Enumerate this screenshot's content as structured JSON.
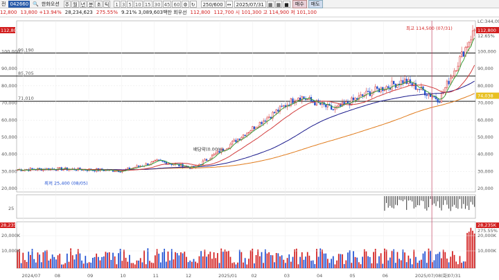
{
  "toolbar": {
    "stock_code": "042660",
    "stock_name": "한화오션",
    "periods": [
      "주",
      "월",
      "년",
      "분",
      "초",
      "틱"
    ],
    "minute_intervals": [
      "1",
      "3",
      "5",
      "10",
      "15",
      "30",
      "45",
      "60"
    ],
    "count_value": "250/600",
    "date_value": "2025/07/31",
    "buy_label": "매수",
    "sell_label": "매도",
    "period_prefix": "전"
  },
  "infobar": {
    "price": "12,800",
    "change": "13,800 +13.94%",
    "volume": "28,234,623",
    "turnover_ratio": "275.55%",
    "summary": "9.21% 3,089,603백만 회우선",
    "open_info": "112,800",
    "high_label": "112,700 시 101,300 고 114,900 저 101,100"
  },
  "chart_data": {
    "type": "candlestick",
    "period": "daily",
    "x_ticks": [
      "2024/07",
      "08",
      "09",
      "10",
      "11",
      "12",
      "2025/01",
      "02",
      "03",
      "04",
      "05",
      "06",
      "2025/07/08(화)",
      "07/31"
    ],
    "price_axis": {
      "ticks": [
        "100,000",
        "90,000",
        "80,000",
        "70,000",
        "60,000",
        "50,000",
        "40,000",
        "30,000",
        "20,000"
      ],
      "ylim": [
        18000,
        118000
      ],
      "current_tag": "112,800",
      "current_tag2": "74,038",
      "lc_label": "LC:344,09",
      "lc_label2": "12.65%"
    },
    "horizontal_lines": [
      {
        "label": "99,190",
        "value": 99190
      },
      {
        "label": "85,705",
        "value": 85705
      },
      {
        "label": "71,010",
        "value": 71010
      }
    ],
    "annotations": {
      "high": "최고 114,500 (07/31)",
      "low": "최저 25,400 (08/05)",
      "dividend": "배당락(0.00%)"
    },
    "monthly_closes_approx": [
      31000,
      31500,
      31000,
      30500,
      36000,
      32000,
      45000,
      60000,
      74000,
      66000,
      76000,
      83000,
      72000,
      112800
    ],
    "ma_long_end": 78000,
    "ma_mid_end": 82000,
    "sub_indicator": {
      "ticks": [
        "25"
      ]
    },
    "volume_axis": {
      "ticks": [
        "20,000K",
        "10,000K"
      ],
      "current_tag": "28,235K",
      "current_tag2": "275.55%"
    }
  },
  "colors": {
    "up": "#d21e1e",
    "down": "#1e4fd2",
    "ma_long": "#e07a1a",
    "ma_mid": "#1a1a8c",
    "ma_short": "#3aa03a",
    "ma_fast": "#d23c3c",
    "axis_tag_red": "#d21e1e"
  }
}
